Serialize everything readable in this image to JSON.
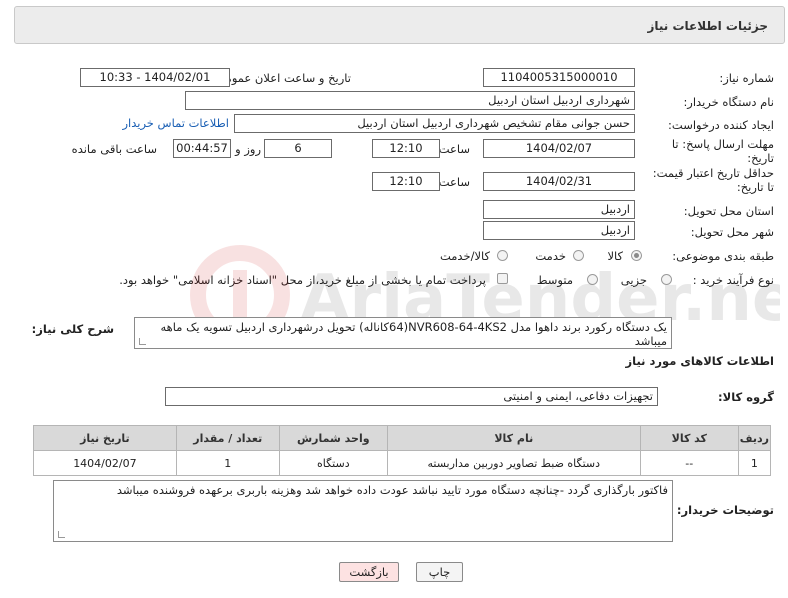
{
  "header": {
    "title": "جزئیات اطلاعات نیاز"
  },
  "fields": {
    "need_number_label": "شماره نیاز:",
    "need_number": "1104005315000010",
    "announce_label": "تاریخ و ساعت اعلان عمومی:",
    "announce_value": "1404/02/01 - 10:33",
    "buyer_org_label": "نام دستگاه خریدار:",
    "buyer_org": "شهرداری اردبیل استان اردبیل",
    "requester_label": "ایجاد کننده درخواست:",
    "requester": "حسن جوانی مقام تشخیص شهرداری اردبیل استان اردبیل",
    "buyer_contact_link": "اطلاعات تماس خریدار",
    "deadline_label_1": "مهلت ارسال پاسخ: تا",
    "deadline_label_2": "تاریخ:",
    "deadline_date": "1404/02/07",
    "time_label": "ساعت",
    "deadline_time": "12:10",
    "days_value": "6",
    "days_label": "روز و",
    "remaining_time": "00:44:57",
    "remaining_label": "ساعت باقی مانده",
    "min_validity_label_1": "حداقل تاریخ اعتبار قیمت:",
    "min_validity_label_2": "تا تاریخ:",
    "validity_date": "1404/02/31",
    "validity_time": "12:10",
    "delivery_province_label": "استان محل تحویل:",
    "delivery_province": "اردبیل",
    "delivery_city_label": "شهر محل تحویل:",
    "delivery_city": "اردبیل",
    "category_label": "طبقه بندی موضوعی:",
    "category_options": [
      "کالا",
      "خدمت",
      "کالا/خدمت"
    ],
    "process_label": "نوع فرآیند خرید :",
    "process_options": [
      "جزیی",
      "متوسط"
    ],
    "payment_note": "پرداخت تمام یا بخشی از مبلغ خرید،از محل \"اسناد خزانه اسلامی\" خواهد بود."
  },
  "description": {
    "label": "شرح کلی نیاز:",
    "text": "یک دستگاه رکورد برند داهوا مدل NVR608-64-4KS2(64کاناله) تحویل درشهرداری اردبیل تسویه یک ماهه میباشد"
  },
  "goods": {
    "section_title": "اطلاعات کالاهای مورد نیاز",
    "group_label": "گروه کالا:",
    "group_value": "تجهیزات دفاعی، ایمنی و امنیتی",
    "columns": [
      "ردیف",
      "کد کالا",
      "نام کالا",
      "واحد شمارش",
      "تعداد / مقدار",
      "تاریخ نیاز"
    ],
    "rows": [
      [
        "1",
        "--",
        "دستگاه ضبط تصاویر دوربین مداربسته",
        "دستگاه",
        "1",
        "1404/02/07"
      ]
    ]
  },
  "buyer_notes": {
    "label": "توضیحات خریدار:",
    "text": "فاکتور بارگذاری گردد -چنانچه دستگاه مورد تایید نباشد عودت داده خواهد شد وهزینه باربری برعهده فروشنده میباشد"
  },
  "buttons": {
    "print": "چاپ",
    "back": "بازگشت"
  },
  "watermark": {
    "text": "AriaTender.neT"
  }
}
